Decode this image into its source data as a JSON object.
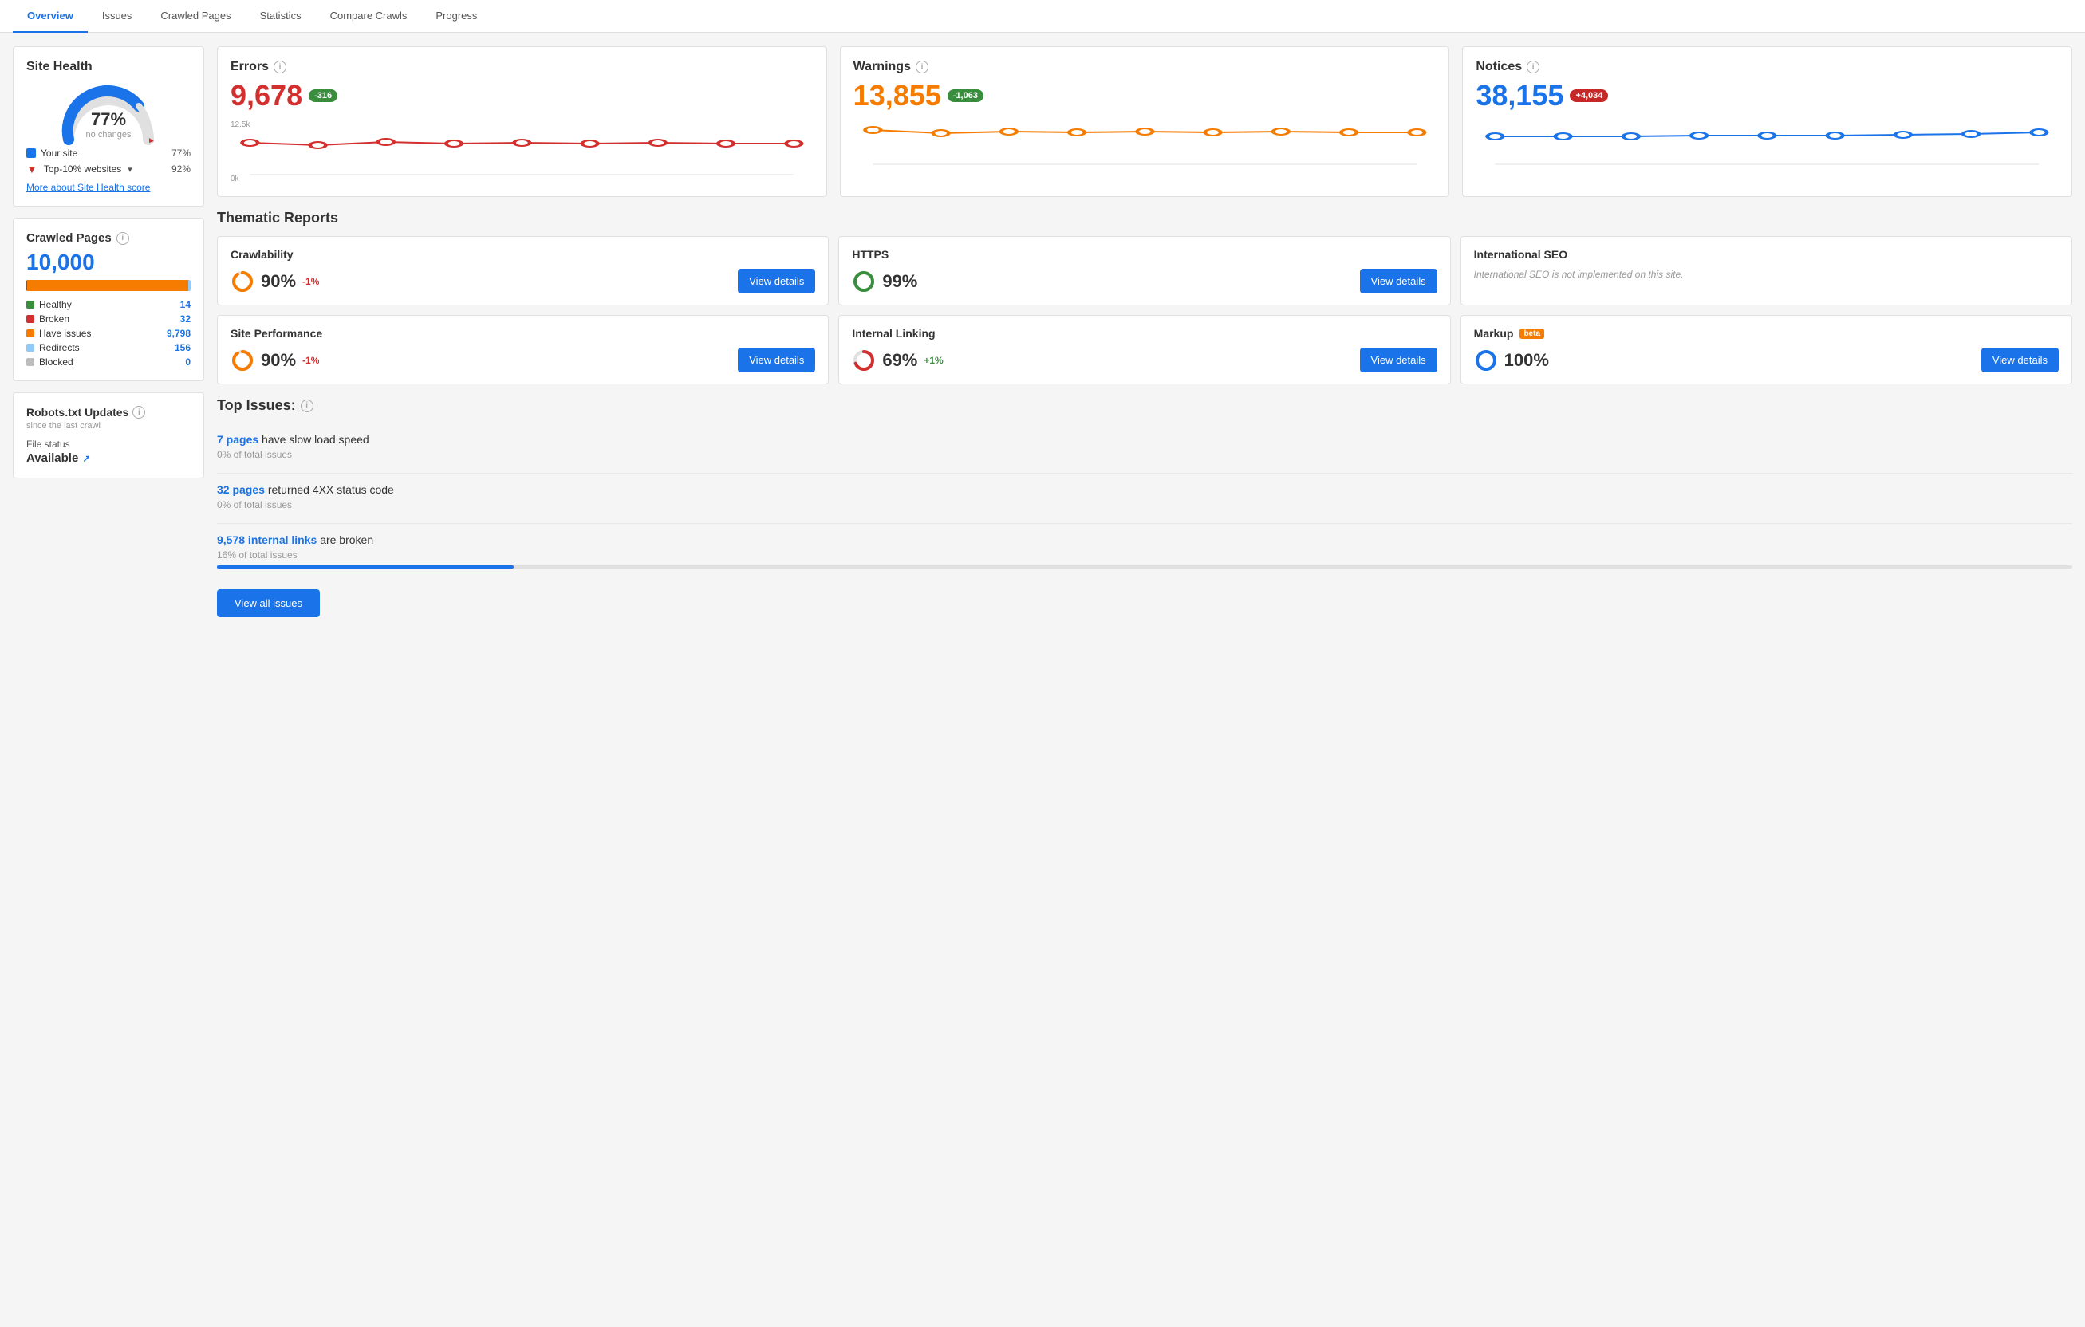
{
  "tabs": [
    {
      "label": "Overview",
      "active": true
    },
    {
      "label": "Issues",
      "active": false
    },
    {
      "label": "Crawled Pages",
      "active": false
    },
    {
      "label": "Statistics",
      "active": false
    },
    {
      "label": "Compare Crawls",
      "active": false
    },
    {
      "label": "Progress",
      "active": false
    }
  ],
  "site_health": {
    "title": "Site Health",
    "percent": "77%",
    "label": "no changes",
    "legend": [
      {
        "name": "Your site",
        "value": "77%",
        "color": "#1a73e8"
      },
      {
        "name": "Top-10% websites",
        "value": "92%",
        "color": "#d32f2f"
      }
    ],
    "more_link": "More about Site Health score"
  },
  "crawled_pages": {
    "title": "Crawled Pages",
    "count": "10,000",
    "bar_segments": [
      {
        "color": "#388e3c",
        "pct": 0.14
      },
      {
        "color": "#d32f2f",
        "pct": 0.32
      },
      {
        "color": "#f57c00",
        "pct": 97.98
      },
      {
        "color": "#90caf9",
        "pct": 1.56
      },
      {
        "color": "#bdbdbd",
        "pct": 0
      }
    ],
    "legend": [
      {
        "name": "Healthy",
        "count": "14",
        "color": "#388e3c"
      },
      {
        "name": "Broken",
        "count": "32",
        "color": "#d32f2f"
      },
      {
        "name": "Have issues",
        "count": "9,798",
        "color": "#f57c00"
      },
      {
        "name": "Redirects",
        "count": "156",
        "color": "#90caf9"
      },
      {
        "name": "Blocked",
        "count": "0",
        "color": "#bdbdbd"
      }
    ]
  },
  "robots": {
    "title": "Robots.txt Updates",
    "subtitle": "since the last crawl",
    "file_status_label": "File status",
    "file_status_value": "Available"
  },
  "errors": {
    "label": "Errors",
    "value": "9,678",
    "badge": "-316",
    "badge_type": "negative",
    "color": "errors",
    "chart_high": "12.5k",
    "chart_low": "0k"
  },
  "warnings": {
    "label": "Warnings",
    "value": "13,855",
    "badge": "-1,063",
    "badge_type": "negative",
    "color": "warnings",
    "chart_high": "20k",
    "chart_low": "0k"
  },
  "notices": {
    "label": "Notices",
    "value": "38,155",
    "badge": "+4,034",
    "badge_type": "positive",
    "color": "notices",
    "chart_high": "50k",
    "chart_low": "0k"
  },
  "thematic_reports": {
    "section_title": "Thematic Reports",
    "reports": [
      {
        "id": "crawlability",
        "title": "Crawlability",
        "score": "90%",
        "change": "-1%",
        "change_type": "negative",
        "has_button": true,
        "button_label": "View details",
        "disabled": false,
        "donut_color": "#f57c00",
        "donut_pct": 90
      },
      {
        "id": "https",
        "title": "HTTPS",
        "score": "99%",
        "change": "",
        "change_type": "",
        "has_button": true,
        "button_label": "View details",
        "disabled": false,
        "donut_color": "#388e3c",
        "donut_pct": 99
      },
      {
        "id": "international-seo",
        "title": "International SEO",
        "score": "",
        "change": "",
        "change_type": "",
        "has_button": false,
        "button_label": "",
        "disabled": true,
        "disabled_text": "International SEO is not implemented on this site.",
        "donut_color": "#ccc",
        "donut_pct": 0
      },
      {
        "id": "site-performance",
        "title": "Site Performance",
        "score": "90%",
        "change": "-1%",
        "change_type": "negative",
        "has_button": true,
        "button_label": "View details",
        "disabled": false,
        "donut_color": "#f57c00",
        "donut_pct": 90
      },
      {
        "id": "internal-linking",
        "title": "Internal Linking",
        "score": "69%",
        "change": "+1%",
        "change_type": "positive",
        "has_button": true,
        "button_label": "View details",
        "disabled": false,
        "donut_color": "#d32f2f",
        "donut_pct": 69
      },
      {
        "id": "markup",
        "title": "Markup",
        "score": "100%",
        "change": "",
        "change_type": "",
        "has_button": true,
        "button_label": "View details",
        "disabled": false,
        "beta": true,
        "donut_color": "#1a73e8",
        "donut_pct": 100
      }
    ]
  },
  "top_issues": {
    "section_title": "Top Issues:",
    "issues": [
      {
        "link_text": "7 pages",
        "description": "have slow load speed",
        "sub": "0% of total issues",
        "bar_pct": 0
      },
      {
        "link_text": "32 pages",
        "description": "returned 4XX status code",
        "sub": "0% of total issues",
        "bar_pct": 0
      },
      {
        "link_text": "9,578 internal links",
        "description": "are broken",
        "sub": "16% of total issues",
        "bar_pct": 16
      }
    ],
    "view_all_label": "View all issues"
  }
}
